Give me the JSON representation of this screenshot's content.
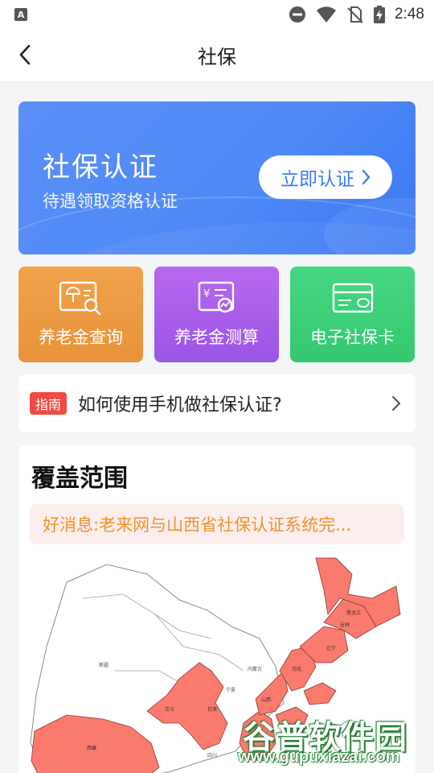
{
  "status_bar": {
    "time": "2:48",
    "left_icon": "A",
    "icons": [
      "dnd-icon",
      "wifi-icon",
      "no-sim-icon",
      "battery-charging-icon"
    ]
  },
  "nav": {
    "title": "社保",
    "back_icon": "chevron-left-icon"
  },
  "banner": {
    "title": "社保认证",
    "subtitle": "待遇领取资格认证",
    "button_label": "立即认证",
    "button_icon": "chevron-right-icon",
    "color": "#4f8af6"
  },
  "tiles": [
    {
      "label": "养老金查询",
      "icon": "pension-search-icon",
      "color": "#ec9a42"
    },
    {
      "label": "养老金测算",
      "icon": "pension-calc-icon",
      "color": "#a95eeb"
    },
    {
      "label": "电子社保卡",
      "icon": "social-card-icon",
      "color": "#3cd078"
    }
  ],
  "guide": {
    "badge": "指南",
    "text": "如何使用手机做社保认证?",
    "icon": "chevron-right-icon"
  },
  "coverage": {
    "title": "覆盖范围",
    "notice": "好消息:老来网与山西省社保认证系统完...",
    "map_highlight_color": "#fa7a6e",
    "map_region_labels": [
      "新疆",
      "西藏",
      "青海",
      "甘肃",
      "四川",
      "内蒙古",
      "黑龙江",
      "吉林",
      "辽宁",
      "宁夏",
      "陕西",
      "山西",
      "河北"
    ]
  },
  "watermark": {
    "main": "谷普软件园",
    "url": "www.gupuxiazai.com"
  }
}
